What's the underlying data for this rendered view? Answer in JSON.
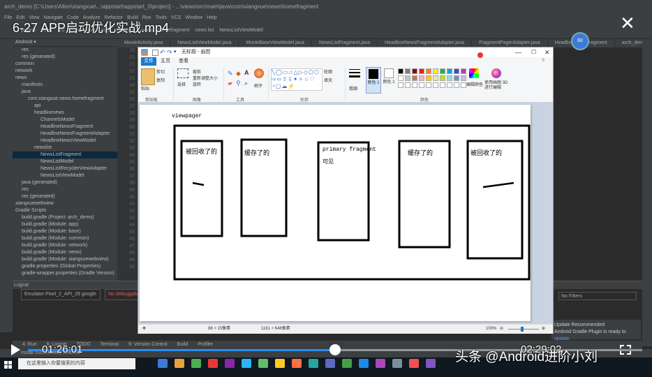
{
  "ide": {
    "titlebar": "arch_demo [C:\\Users\\Allen\\xiangxue\\...\\appstart\\appstart_0\\project] - ...\\views\\src\\main\\java\\com\\xiangxue\\news\\homefragment",
    "menu": [
      "File",
      "Edit",
      "View",
      "Navigate",
      "Code",
      "Analyze",
      "Refactor",
      "Build",
      "Run",
      "Tools",
      "VCS",
      "Window",
      "Help"
    ],
    "toolbar_crumbs": [
      "project",
      "news",
      "src",
      "main",
      "java",
      "com",
      "xiangxue",
      "news",
      "homefragment",
      "news list",
      "NewsListViewModel"
    ],
    "editor_tabs": [
      "MovieActivity.java",
      "NewsListViewModel.java",
      "MovieBaseViewModel.java",
      "NewsListFragment.java",
      "HeadlineNewsFragmentAdapter.java",
      "FragmentPagerAdapter.java",
      "HeadlineNewsFragment",
      "arch_demo"
    ],
    "project_dropdown": "Android",
    "tree": [
      {
        "label": "res",
        "indent": 1
      },
      {
        "label": "res (generated)",
        "indent": 1
      },
      {
        "label": "common",
        "indent": 0
      },
      {
        "label": "network",
        "indent": 0
      },
      {
        "label": "news",
        "indent": 0
      },
      {
        "label": "manifests",
        "indent": 1
      },
      {
        "label": "java",
        "indent": 1
      },
      {
        "label": "com.xiangxue.news.homefragment",
        "indent": 2
      },
      {
        "label": "api",
        "indent": 3
      },
      {
        "label": "headlinenews",
        "indent": 3
      },
      {
        "label": "ChannelsModel",
        "indent": 4
      },
      {
        "label": "HeadlineNewsFragment",
        "indent": 4
      },
      {
        "label": "HeadlineNewsFragmentAdapter",
        "indent": 4
      },
      {
        "label": "HeadlineNewsViewModel",
        "indent": 4
      },
      {
        "label": "newslist",
        "indent": 3
      },
      {
        "label": "NewsListFragment",
        "indent": 4
      },
      {
        "label": "NewsListModel",
        "indent": 4
      },
      {
        "label": "NewsListRecyclerViewAdapter",
        "indent": 4
      },
      {
        "label": "NewsListViewModel",
        "indent": 4
      },
      {
        "label": "java (generated)",
        "indent": 1
      },
      {
        "label": "res",
        "indent": 1
      },
      {
        "label": "res (generated)",
        "indent": 1
      },
      {
        "label": "xiangxuewebview",
        "indent": 0
      },
      {
        "label": "Gradle Scripts",
        "indent": 0
      },
      {
        "label": "build.gradle (Project: arch_demo)",
        "indent": 1
      },
      {
        "label": "build.gradle (Module: app)",
        "indent": 1
      },
      {
        "label": "build.gradle (Module: base)",
        "indent": 1
      },
      {
        "label": "build.gradle (Module: common)",
        "indent": 1
      },
      {
        "label": "build.gradle (Module: network)",
        "indent": 1
      },
      {
        "label": "build.gradle (Module: news)",
        "indent": 1
      },
      {
        "label": "build.gradle (Module: xiangxuewebview)",
        "indent": 1
      },
      {
        "label": "gradle.properties (Global Properties)",
        "indent": 1
      },
      {
        "label": "gradle-wrapper.properties (Gradle Version)",
        "indent": 1
      }
    ],
    "highlight_index": 15,
    "gutter": [
      "19",
      "20",
      "21",
      "22",
      "23",
      "24",
      "25",
      "26",
      "27",
      "28",
      "29",
      "30",
      "31",
      "32",
      "33",
      "34",
      "35",
      "36",
      "37",
      "38",
      "39",
      "40",
      "41",
      "42",
      "43",
      "44",
      "45",
      "46",
      "47",
      "48",
      "49",
      "50"
    ],
    "logcat": {
      "title": "Logcat",
      "device": "Emulator Pixel_2_API_29 google",
      "process": "No debuggable proc",
      "filter": "No Filters"
    },
    "update": {
      "title": "Update Recommended",
      "body": "Android Gradle Plugin is ready to",
      "link": "update."
    },
    "bottom_tabs": [
      "4: Run",
      "6: Logcat",
      "TODO",
      "Terminal",
      "9: Version Control",
      "Build",
      "Profiler"
    ],
    "status": "Install successfully finished",
    "taskbar_search": "在这里输入你要搜索的内容"
  },
  "video": {
    "title": "6-27 APP启动优化实战.mp4",
    "current_time": "01:26:01",
    "total_time": "02:29:02",
    "progress": 0.5,
    "fps_badge": "60",
    "watermark": "头条 @Android进阶小刘"
  },
  "paint": {
    "title": "无标题 - 画图",
    "tabs": {
      "file": "文件",
      "home": "主页",
      "view": "查看"
    },
    "groups": {
      "clipboard": "剪贴板",
      "image": "图像",
      "tools": "工具",
      "shapes": "形状",
      "colors": "颜色"
    },
    "buttons": {
      "paste": "粘贴",
      "cut": "剪切",
      "copy": "复制",
      "select": "选择",
      "crop": "裁剪",
      "resize": "重新调整大小",
      "rotate": "旋转",
      "brush": "刷子",
      "outline": "轮廓",
      "fill": "填充",
      "size": "粗细",
      "color1": "颜色 1",
      "color2": "颜色 2",
      "edit_colors": "编辑颜色",
      "paint3d": "使用画图 3D 进行编辑"
    },
    "palette": [
      "#000000",
      "#7f7f7f",
      "#880015",
      "#ed1c24",
      "#ff7f27",
      "#fff200",
      "#22b14c",
      "#00a2e8",
      "#3f48cc",
      "#a349a4",
      "#ffffff",
      "#c3c3c3",
      "#b97a57",
      "#ffaec9",
      "#ffc90e",
      "#efe4b0",
      "#b5e61d",
      "#99d9ea",
      "#7092be",
      "#c8bfe7"
    ],
    "status": {
      "size1": "88 × 15像素",
      "size2": "1161 × 648像素",
      "zoom": "100%"
    },
    "canvas": {
      "viewpager_label": "viewpager",
      "cards": [
        {
          "label": "被回收了的"
        },
        {
          "label": "缓存了的"
        },
        {
          "label": "primary fragment",
          "label2": "可见"
        },
        {
          "label": "缓存了的"
        },
        {
          "label": "被回收了的"
        }
      ]
    }
  }
}
